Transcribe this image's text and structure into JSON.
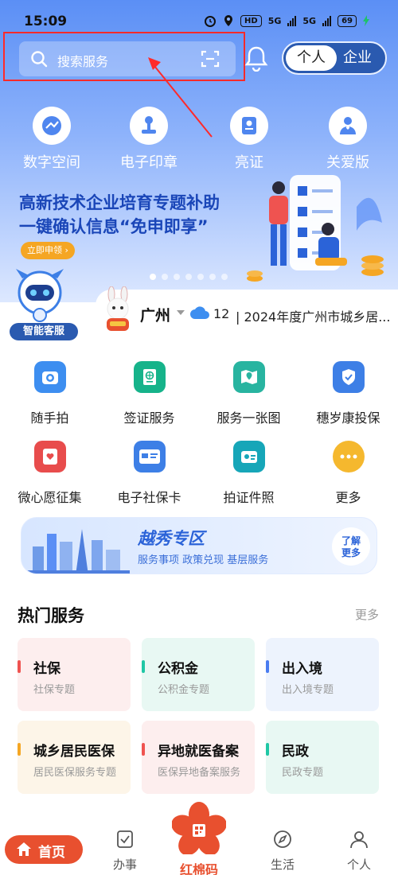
{
  "status_bar": {
    "time": "15:09",
    "hd": "HD",
    "net1": "5G",
    "net2": "5G",
    "battery": "69"
  },
  "header": {
    "search_placeholder": "搜索服务",
    "toggle_active": "个人",
    "toggle_inactive": "企业"
  },
  "quick_links": [
    {
      "label": "数字空间",
      "icon": "digital-space-icon"
    },
    {
      "label": "电子印章",
      "icon": "seal-icon"
    },
    {
      "label": "亮证",
      "icon": "certificate-icon"
    },
    {
      "label": "关爱版",
      "icon": "care-mode-icon"
    }
  ],
  "banner": {
    "line1": "高新技术企业培育专题补助",
    "line2": "一键确认信息“免申即享”",
    "cta": "立即申领"
  },
  "assistant": {
    "label": "智能客服"
  },
  "info_bar": {
    "city": "广州",
    "temperature": "12",
    "news": "| 2024年度广州市城乡居..."
  },
  "services": [
    {
      "label": "随手拍",
      "icon": "camera-icon",
      "color": "#3d8ef0"
    },
    {
      "label": "签证服务",
      "icon": "passport-icon",
      "color": "#16b38a"
    },
    {
      "label": "服务一张图",
      "icon": "map-icon",
      "color": "#28b4a0"
    },
    {
      "label": "穗岁康投保",
      "icon": "shield-icon",
      "color": "#3d7fe6"
    },
    {
      "label": "微心愿征集",
      "icon": "heart-card-icon",
      "color": "#e84c4c"
    },
    {
      "label": "电子社保卡",
      "icon": "social-card-icon",
      "color": "#3d7fe6"
    },
    {
      "label": "拍证件照",
      "icon": "id-photo-icon",
      "color": "#16a6b8"
    },
    {
      "label": "更多",
      "icon": "more-icon",
      "color": "#f5b82e"
    }
  ],
  "zone": {
    "title": "越秀专区",
    "subtitle": "服务事项  政策兑现  基层服务",
    "more_line1": "了解",
    "more_line2": "更多"
  },
  "hot_services": {
    "title": "热门服务",
    "more": "更多",
    "cards": [
      {
        "title": "社保",
        "subtitle": "社保专题",
        "accent": "#ef5350",
        "bg": "#fdeeee"
      },
      {
        "title": "公积金",
        "subtitle": "公积金专题",
        "accent": "#1fc7a5",
        "bg": "#e8f8f3"
      },
      {
        "title": "出入境",
        "subtitle": "出入境专题",
        "accent": "#4a7cf0",
        "bg": "#edf3fd"
      },
      {
        "title": "城乡居民医保",
        "subtitle": "居民医保服务专题",
        "accent": "#f5a623",
        "bg": "#fdf5e8"
      },
      {
        "title": "异地就医备案",
        "subtitle": "医保异地备案服务",
        "accent": "#ef5350",
        "bg": "#fdeeee"
      },
      {
        "title": "民政",
        "subtitle": "民政专题",
        "accent": "#1fc7a5",
        "bg": "#e8f8f3"
      }
    ]
  },
  "tabbar": {
    "home": "首页",
    "tasks": "办事",
    "center": "红棉码",
    "life": "生活",
    "me": "个人"
  }
}
